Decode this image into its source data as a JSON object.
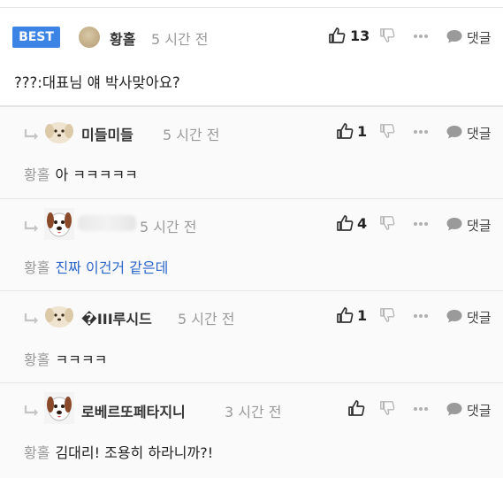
{
  "main_comment": {
    "badge": "BEST",
    "nickname": "황홀",
    "time": "5 시간 전",
    "likes": "13",
    "text": "???:대표님 얘 박사맞아요?",
    "reply_label": "댓글",
    "more": "···"
  },
  "replies": [
    {
      "nickname": "미들미들",
      "time": "5 시간 전",
      "likes": "1",
      "mention": "황홀",
      "text": "아 ㅋㅋㅋㅋㅋ",
      "reply_label": "댓글",
      "more": "···"
    },
    {
      "nickname": "",
      "time": "5 시간 전",
      "likes": "4",
      "mention": "황홀",
      "text": "진짜 이건거 같은데",
      "reply_label": "댓글",
      "more": "···"
    },
    {
      "nickname": "�III루시드",
      "time": "5 시간 전",
      "likes": "1",
      "mention": "황홀",
      "text": "ㅋㅋㅋㅋ",
      "reply_label": "댓글",
      "more": "···"
    },
    {
      "nickname": "로베르또페타지니",
      "time": "3 시간 전",
      "likes": "",
      "mention": "황홀",
      "text": "김대리! 조용히 하라니까?!",
      "reply_label": "댓글",
      "more": "···"
    }
  ],
  "colors": {
    "best_badge": "#3c83e6",
    "link_text": "#2a66c9",
    "muted": "#9a9a9a"
  }
}
